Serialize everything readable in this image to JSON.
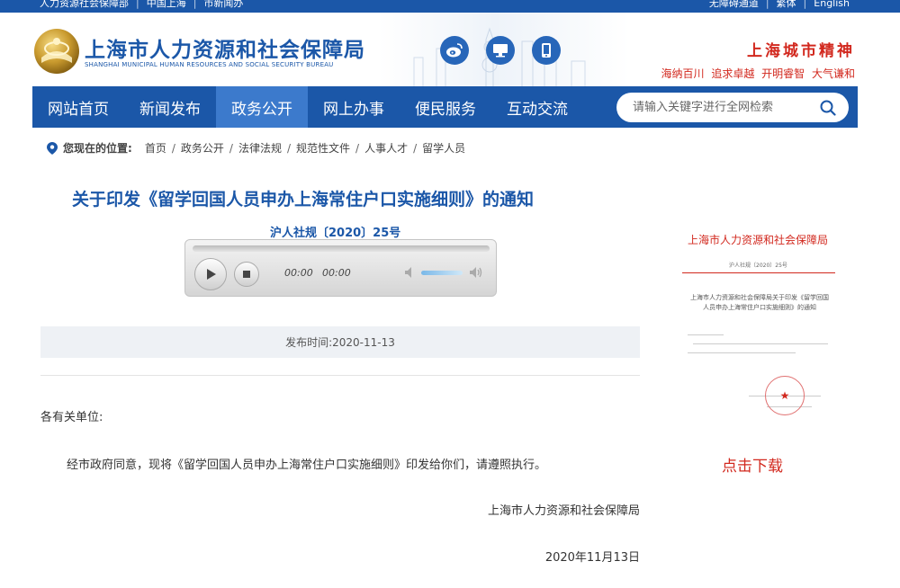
{
  "topbar": {
    "left_links": [
      "人力资源社会保障部",
      "中国上海",
      "市新闻办"
    ],
    "right_links": [
      "无障碍通道",
      "繁体",
      "English"
    ]
  },
  "header": {
    "title": "上海市人力资源和社会保障局",
    "subtitle": "SHANGHAI MUNICIPAL HUMAN RESOURCES AND SOCIAL SECURITY BUREAU",
    "social_icons": [
      "weibo-icon",
      "desktop-icon",
      "mobile-icon"
    ],
    "spirit_title": "上海城市精神",
    "spirit_text": "海纳百川 追求卓越 开明睿智 大气谦和"
  },
  "nav": {
    "items": [
      {
        "label": "网站首页"
      },
      {
        "label": "新闻发布"
      },
      {
        "label": "政务公开",
        "active": true
      },
      {
        "label": "网上办事"
      },
      {
        "label": "便民服务"
      },
      {
        "label": "互动交流"
      }
    ],
    "search_placeholder": "请输入关键字进行全网检索"
  },
  "breadcrumb": {
    "label": "您现在的位置:",
    "items": [
      "首页",
      "政务公开",
      "法律法规",
      "规范性文件",
      "人事人才",
      "留学人员"
    ]
  },
  "article": {
    "title": "关于印发《留学回国人员申办上海常住户口实施细则》的通知",
    "doc_number": "沪人社规〔2020〕25号",
    "player": {
      "current_time": "00:00",
      "duration": "00:00"
    },
    "publish_label": "发布时间:",
    "publish_date": "2020-11-13",
    "salutation": "各有关单位:",
    "paragraph": "经市政府同意，现将《留学回国人员申办上海常住户口实施细则》印发给你们，请遵照执行。",
    "signature": "上海市人力资源和社会保障局",
    "sign_date": "2020年11月13日"
  },
  "sidebar": {
    "preview_header": "上海市人力资源和社会保障局",
    "preview_docno": "沪人社规〔2020〕25号",
    "preview_caption": "上海市人力资源和社会保障局关于印发《留学回国人员申办上海常住户口实施细则》的通知",
    "download_label": "点击下载"
  },
  "colors": {
    "brand_blue": "#1b57a8",
    "nav_active": "#3c7acc",
    "accent_red": "#d2281e"
  }
}
